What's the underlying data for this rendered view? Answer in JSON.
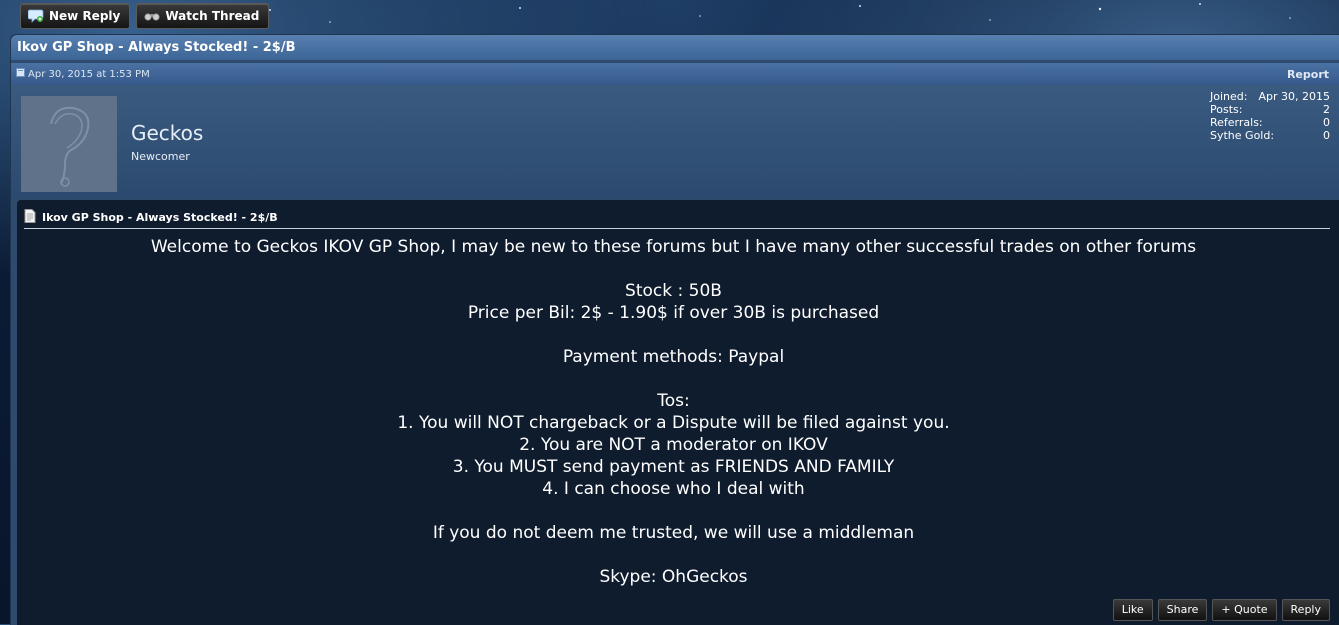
{
  "toolbar": {
    "new_reply": "New Reply",
    "watch_thread": "Watch Thread"
  },
  "thread": {
    "title": "Ikov GP Shop - Always Stocked! - 2$/B"
  },
  "post": {
    "date": "Apr 30, 2015 at 1:53 PM",
    "report": "Report",
    "title": "Ikov GP Shop - Always Stocked! - 2$/B",
    "lines": [
      "Welcome to Geckos IKOV GP Shop, I may be new to these forums but I have many other successful trades on other forums",
      "",
      "Stock : 50B",
      "Price per Bil: 2$ - 1.90$ if over 30B is purchased",
      "",
      "Payment methods: Paypal",
      "",
      "Tos:",
      "1. You will NOT chargeback or a Dispute will be filed against you.",
      "2. You are NOT a moderator on IKOV",
      "3. You MUST send payment as FRIENDS AND FAMILY",
      "4. I can choose who I deal with",
      "",
      "If you do not deem me trusted, we will use a middleman",
      "",
      "Skype: OhGeckos"
    ]
  },
  "user": {
    "name": "Geckos",
    "title": "Newcomer",
    "stats": [
      {
        "label": "Joined:",
        "value": "Apr 30, 2015"
      },
      {
        "label": "Posts:",
        "value": "2"
      },
      {
        "label": "Referrals:",
        "value": "0"
      },
      {
        "label": "Sythe Gold:",
        "value": "0"
      }
    ]
  },
  "actions": {
    "like": "Like",
    "share": "Share",
    "quote": "+ Quote",
    "reply": "Reply"
  },
  "colors": {
    "panel": "#2e4a6c",
    "title_bar": "#4a72a3",
    "content_bg": "#0f1c2e"
  }
}
